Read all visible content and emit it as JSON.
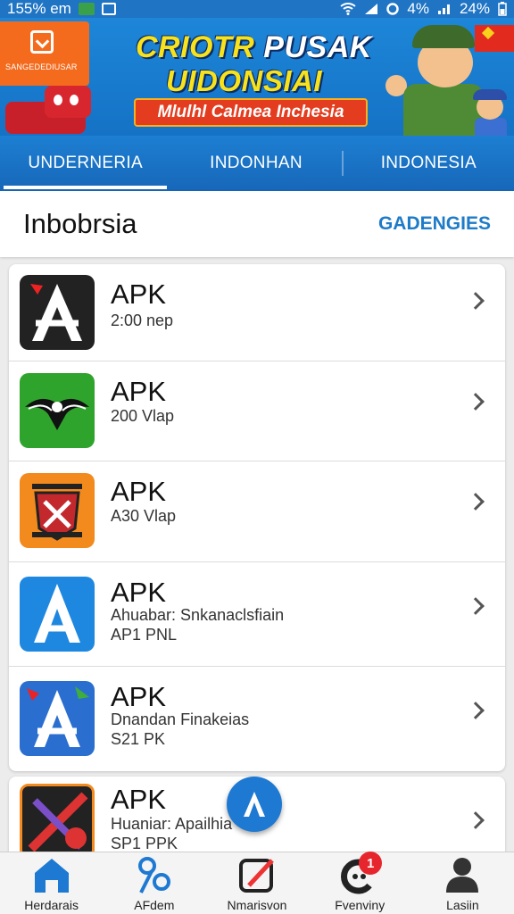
{
  "status_bar": {
    "left_text": "155% em",
    "battery_text": "4%",
    "signal_text": "24%"
  },
  "banner": {
    "logo_text": "SANGEDEDIUSAR",
    "title_line1_a": "CRIOTR ",
    "title_line1_b": "PUSAK",
    "title_line2": "UIDONSIAI",
    "ribbon": "Mlulhl Calmea Inchesia"
  },
  "tabs": [
    {
      "label": "UNDERNERIA",
      "active": true
    },
    {
      "label": "INDONHAN",
      "active": false
    },
    {
      "label": "INDONESIA",
      "active": false
    }
  ],
  "section": {
    "title": "Inbobrsia",
    "link": "GADENGIES"
  },
  "apps": [
    {
      "title": "APK",
      "line1": "2:00 nep",
      "line2": ""
    },
    {
      "title": "APK",
      "line1": "200 Vlap",
      "line2": ""
    },
    {
      "title": "APK",
      "line1": "A30 Vlap",
      "line2": ""
    },
    {
      "title": "APK",
      "line1": "Ahuabar: Snkanaclsfiain",
      "line2": "AP1 PNL"
    },
    {
      "title": "APK",
      "line1": "Dnandan Finakeias",
      "line2": "S21 PK"
    },
    {
      "title": "APK",
      "line1": "Huaniar: Apailhia",
      "line2": "SP1 PPK"
    }
  ],
  "bottom_nav": [
    {
      "label": "Herdarais",
      "icon": "home-icon"
    },
    {
      "label": "AFdem",
      "icon": "share-icon"
    },
    {
      "label": "Nmarisvon",
      "icon": "edit-icon"
    },
    {
      "label": "Fvenviny",
      "icon": "chat-icon",
      "badge": "1"
    },
    {
      "label": "Lasiin",
      "icon": "user-icon"
    }
  ],
  "colors": {
    "primary": "#1f74c4",
    "accent": "#1e7bc8",
    "badge": "#e6262c"
  }
}
